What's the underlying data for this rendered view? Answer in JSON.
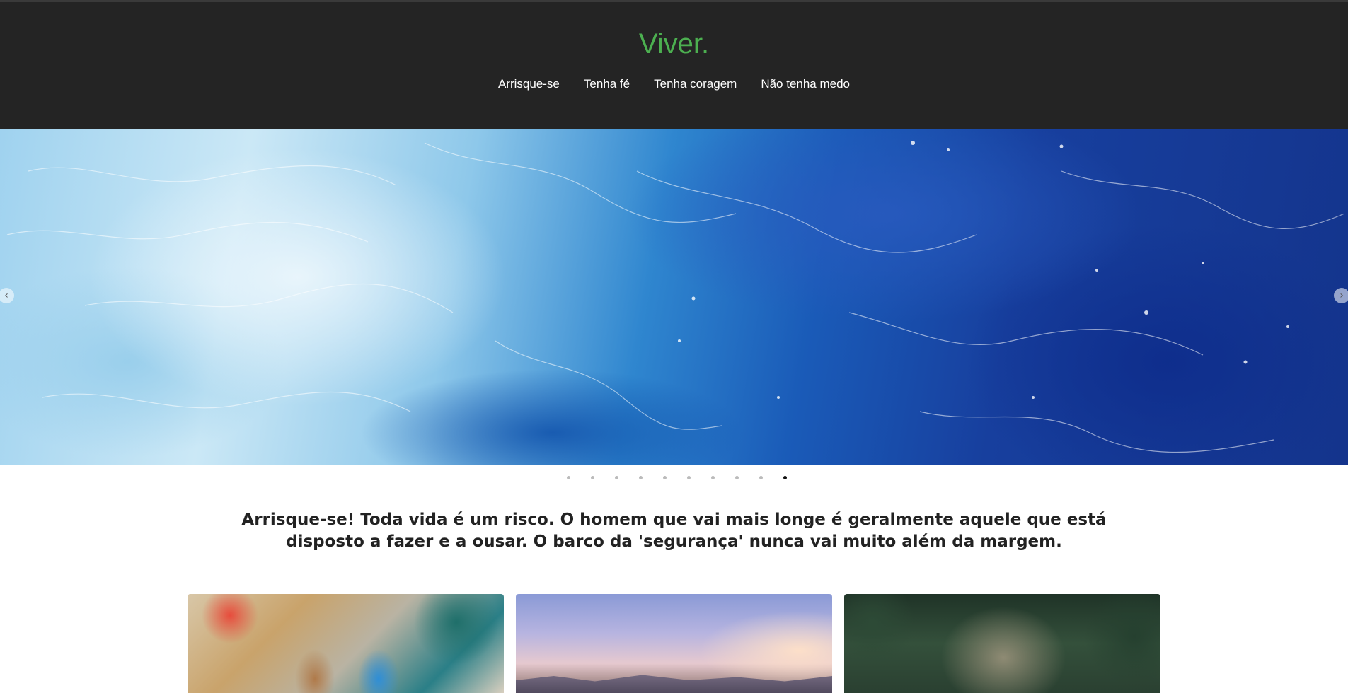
{
  "site": {
    "title": "Viver.",
    "brand_color": "#4caf50",
    "header_bg": "#242424"
  },
  "nav": {
    "items": [
      {
        "label": "Arrisque-se"
      },
      {
        "label": "Tenha fé"
      },
      {
        "label": "Tenha coragem"
      },
      {
        "label": "Não tenha medo"
      }
    ]
  },
  "slider": {
    "image": "ocean-waves-photo",
    "prev_icon": "chevron-left-icon",
    "next_icon": "chevron-right-icon",
    "prev_glyph": "‹",
    "next_glyph": "›",
    "slide_count": 10,
    "active_slide": 10
  },
  "quote": {
    "text": "Arrisque-se! Toda vida é um risco. O homem que vai mais longe é geralmente aquele que está disposto a fazer e a ousar. O barco da 'segurança' nunca vai muito além da margem."
  },
  "cards": [
    {
      "image": "painted-shoes-photo"
    },
    {
      "image": "mountain-sunrise-photo"
    },
    {
      "image": "garden-gate-photo"
    }
  ]
}
